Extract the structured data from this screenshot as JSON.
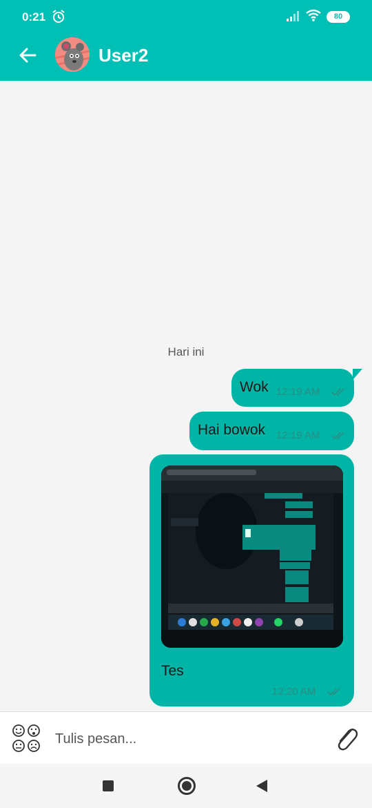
{
  "status_bar": {
    "time": "0:21",
    "battery": "80"
  },
  "header": {
    "contact_name": "User2",
    "avatar_icon": "cartoon-mouse-avatar"
  },
  "chat": {
    "date_separator": "Hari ini",
    "messages": [
      {
        "text": "Wok",
        "time": "12:19 AM",
        "status": "read-double-check"
      },
      {
        "text": "Hai bowok",
        "time": "12:19 AM",
        "status": "read-double-check"
      },
      {
        "text": "Tes",
        "time": "12:20 AM",
        "status": "read-double-check",
        "has_image": true
      }
    ]
  },
  "composer": {
    "placeholder": "Tulis pesan..."
  },
  "colors": {
    "primary": "#00bfb5",
    "bubble": "#00b4a6",
    "background": "#f4f4f4"
  }
}
